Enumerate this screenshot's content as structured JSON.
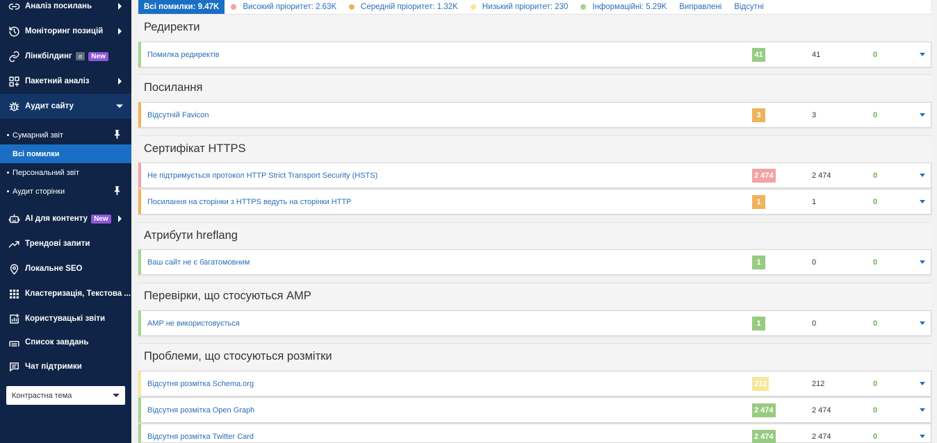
{
  "sidebar": {
    "items": [
      {
        "label": "Аналіз посилань",
        "icon": "link-icon"
      },
      {
        "label": "Моніторинг позицій",
        "icon": "history-icon"
      },
      {
        "label": "Лінкбілдинг",
        "icon": "chain-icon",
        "badge_alpha": "α",
        "badge": "New"
      },
      {
        "label": "Пакетний аналіз",
        "icon": "grid-plus-icon"
      },
      {
        "label": "Аудит сайту",
        "icon": "bug-icon"
      },
      {
        "label": "AI для контенту",
        "icon": "robot-icon",
        "badge": "New"
      },
      {
        "label": "Трендові запити",
        "icon": "trend-icon"
      },
      {
        "label": "Локальне SEO",
        "icon": "location-pin-icon"
      },
      {
        "label": "Кластеризація, Текстова ...",
        "icon": "grid-dots-icon"
      },
      {
        "label": "Користувацькі звіти",
        "icon": "add-report-icon"
      },
      {
        "label": "Список завдань",
        "icon": "task-list-icon"
      },
      {
        "label": "Чат підтримки",
        "icon": "chat-icon"
      }
    ],
    "subitems": [
      {
        "label": "Сумарний звіт"
      },
      {
        "label": "Всі помилки"
      },
      {
        "label": "Персональний звіт"
      },
      {
        "label": "Аудит сторінки"
      }
    ],
    "theme_select": "Контрастна тема"
  },
  "filters": {
    "all": "Всі помилки: 9.47K",
    "high": "Високий пріоритет: 2.63K",
    "medium": "Середній пріоритет: 1.32K",
    "low": "Низький пріоритет: 230",
    "info": "Інформаційні: 5.29K",
    "fixed": "Виправлені",
    "missing": "Відсутні",
    "colors": {
      "high": "#f4a3a3",
      "medium": "#f0b25a",
      "low": "#f6e79a",
      "info": "#a5d48e",
      "accent": "#1a6fc4"
    }
  },
  "sections": [
    {
      "title": "Редиректи",
      "rows": [
        {
          "name": "Помилка редиректів",
          "badge": "41",
          "level": "green",
          "total": "41",
          "fixed": "0"
        }
      ]
    },
    {
      "title": "Посилання",
      "rows": [
        {
          "name": "Відсутній Favicon",
          "badge": "3",
          "level": "orange",
          "total": "3",
          "fixed": "0"
        }
      ]
    },
    {
      "title": "Сертифікат HTTPS",
      "rows": [
        {
          "name": "Не підтримується протокол HTTP Strict Transport Security (HSTS)",
          "badge": "2 474",
          "level": "red",
          "total": "2 474",
          "fixed": "0"
        },
        {
          "name": "Посилання на сторінки з HTTPS ведуть на сторінки HTTP",
          "badge": "1",
          "level": "orange",
          "total": "1",
          "fixed": "0"
        }
      ]
    },
    {
      "title": "Атрибути hreflang",
      "rows": [
        {
          "name": "Ваш сайт не є багатомовним",
          "badge": "1",
          "level": "green",
          "total": "0",
          "fixed": "0"
        }
      ]
    },
    {
      "title": "Перевірки, що стосуються AMP",
      "rows": [
        {
          "name": "AMP не використовується",
          "badge": "1",
          "level": "green",
          "total": "0",
          "fixed": "0"
        }
      ]
    },
    {
      "title": "Проблеми, що стосуються розмітки",
      "rows": [
        {
          "name": "Відсутня розмітка Schema.org",
          "badge": "212",
          "level": "yellow",
          "total": "212",
          "fixed": "0"
        },
        {
          "name": "Відсутня розмітка Open Graph",
          "badge": "2 474",
          "level": "green",
          "total": "2 474",
          "fixed": "0"
        },
        {
          "name": "Відсутня розмітка Twitter Card",
          "badge": "2 474",
          "level": "green",
          "total": "2 474",
          "fixed": "0"
        }
      ]
    }
  ]
}
